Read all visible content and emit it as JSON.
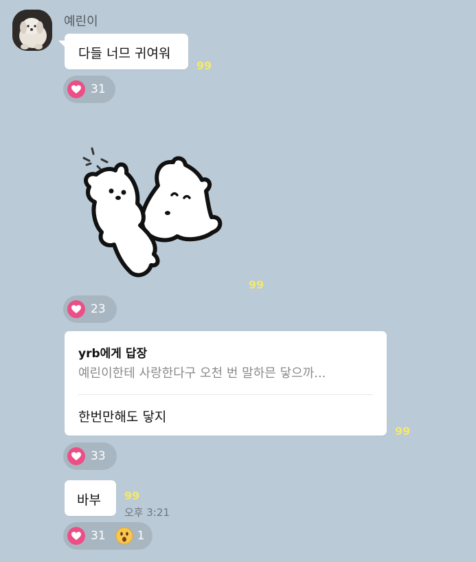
{
  "sender": {
    "name": "예린이",
    "avatar": "dog-avatar"
  },
  "messages": [
    {
      "text": "다들 너므 귀여워",
      "read_count": "99",
      "reactions": [
        {
          "icon": "heart-icon",
          "count": "31"
        }
      ]
    },
    {
      "type": "sticker",
      "sticker": "two-white-bears-sticker",
      "read_count": "99",
      "reactions": [
        {
          "icon": "heart-icon",
          "count": "23"
        }
      ]
    },
    {
      "type": "reply",
      "reply_to": "yrb에게 답장",
      "quote": "예린이한테 사랑한다구 오천 번 말하믄 닿으까...",
      "text": "한번만해도 닿지",
      "read_count": "99",
      "reactions": [
        {
          "icon": "heart-icon",
          "count": "33"
        }
      ]
    },
    {
      "text": "바부",
      "read_count": "99",
      "time": "오후 3:21",
      "reactions": [
        {
          "icon": "heart-icon",
          "count": "31"
        },
        {
          "icon": "surprised-face-icon",
          "count": "1"
        }
      ]
    }
  ],
  "colors": {
    "background": "#bacad7",
    "bubble": "#ffffff",
    "read_count": "#f4e96b",
    "heart": "#ec4f86",
    "reaction_pill": "#a8b6c1"
  }
}
